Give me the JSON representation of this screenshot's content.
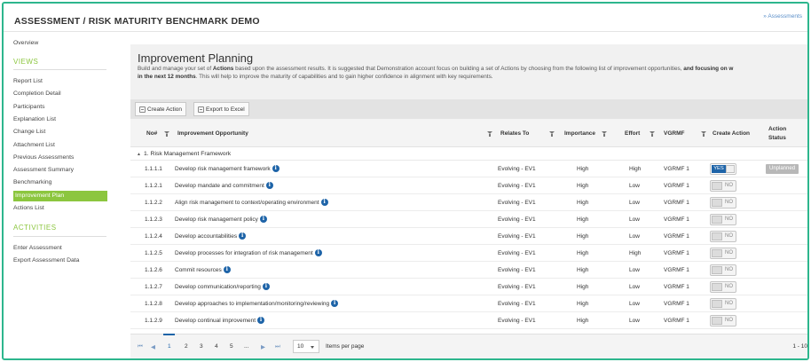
{
  "app": {
    "title": "ASSESSMENT / RISK MATURITY BENCHMARK DEMO",
    "breadcrumb": "» Assessments"
  },
  "sidebar": {
    "overview": "Overview",
    "views_heading": "VIEWS",
    "views": [
      "Report List",
      "Completion Detail",
      "Participants",
      "Explanation List",
      "Change List",
      "Attachment List",
      "Previous Assessments",
      "Assessment Summary",
      "Benchmarking",
      "Improvement Plan",
      "Actions List"
    ],
    "active_index": 9,
    "activities_heading": "ACTIVITIES",
    "activities": [
      "Enter Assessment",
      "Export Assessment Data"
    ]
  },
  "main": {
    "title": "Improvement Planning",
    "desc_line1_a": "Build and manage your set of ",
    "desc_line1_b": "Actions",
    "desc_line1_c": " based upon the assessment results. It is suggested that Demonstration account focus on building a set of Actions by choosing from the following list of improvement opportunities, ",
    "desc_line1_d": "and focusing on w",
    "desc_line2_a": "in the next 12 months",
    "desc_line2_b": ". This will help to improve the maturity of capabilities and to gain higher confidence in alignment with key requirements.",
    "create_action_label": "Create Action",
    "export_label": "Export to Excel"
  },
  "table": {
    "headers": {
      "no": "No#",
      "opportunity": "Improvement Opportunity",
      "relates_to": "Relates To",
      "importance": "Importance",
      "effort": "Effort",
      "vgrmf": "VGRMF",
      "create_action": "Create Action",
      "status_1": "Action",
      "status_2": "Status"
    },
    "group_label": "1. Risk Management Framework",
    "rows": [
      {
        "no": "1.1.1.1",
        "opportunity": "Develop risk management framework",
        "relates": "Evolving - EV1",
        "importance": "High",
        "effort": "High",
        "vgrmf": "VGRMF 1",
        "action": "YES",
        "status": "Unplanned"
      },
      {
        "no": "1.1.2.1",
        "opportunity": "Develop mandate and commitment",
        "relates": "Evolving - EV1",
        "importance": "High",
        "effort": "Low",
        "vgrmf": "VGRMF 1",
        "action": "NO",
        "status": ""
      },
      {
        "no": "1.1.2.2",
        "opportunity": "Align risk management to context/operating environment",
        "relates": "Evolving - EV1",
        "importance": "High",
        "effort": "Low",
        "vgrmf": "VGRMF 1",
        "action": "NO",
        "status": ""
      },
      {
        "no": "1.1.2.3",
        "opportunity": "Develop risk management policy",
        "relates": "Evolving - EV1",
        "importance": "High",
        "effort": "Low",
        "vgrmf": "VGRMF 1",
        "action": "NO",
        "status": ""
      },
      {
        "no": "1.1.2.4",
        "opportunity": "Develop accountabilities",
        "relates": "Evolving - EV1",
        "importance": "High",
        "effort": "Low",
        "vgrmf": "VGRMF 1",
        "action": "NO",
        "status": ""
      },
      {
        "no": "1.1.2.5",
        "opportunity": "Develop processes for integration of risk management",
        "relates": "Evolving - EV1",
        "importance": "High",
        "effort": "High",
        "vgrmf": "VGRMF 1",
        "action": "NO",
        "status": ""
      },
      {
        "no": "1.1.2.6",
        "opportunity": "Commit resources",
        "relates": "Evolving - EV1",
        "importance": "High",
        "effort": "Low",
        "vgrmf": "VGRMF 1",
        "action": "NO",
        "status": ""
      },
      {
        "no": "1.1.2.7",
        "opportunity": "Develop communication/reporting",
        "relates": "Evolving - EV1",
        "importance": "High",
        "effort": "Low",
        "vgrmf": "VGRMF 1",
        "action": "NO",
        "status": ""
      },
      {
        "no": "1.1.2.8",
        "opportunity": "Develop approaches to implementation/monitoring/reviewing",
        "relates": "Evolving - EV1",
        "importance": "High",
        "effort": "Low",
        "vgrmf": "VGRMF 1",
        "action": "NO",
        "status": ""
      },
      {
        "no": "1.1.2.9",
        "opportunity": "Develop continual improvement",
        "relates": "Evolving - EV1",
        "importance": "High",
        "effort": "Low",
        "vgrmf": "VGRMF 1",
        "action": "NO",
        "status": ""
      }
    ]
  },
  "pager": {
    "first": "⏮",
    "prev": "◀",
    "pages": [
      "1",
      "2",
      "3",
      "4",
      "5",
      "..."
    ],
    "next": "▶",
    "last": "⏭",
    "page_size": "10",
    "items_per_page": "Items per page",
    "range": "1 - 10"
  },
  "colors": {
    "accent_green": "#8cc63f",
    "frame": "#2db68d",
    "primary_blue": "#1e64a8"
  }
}
